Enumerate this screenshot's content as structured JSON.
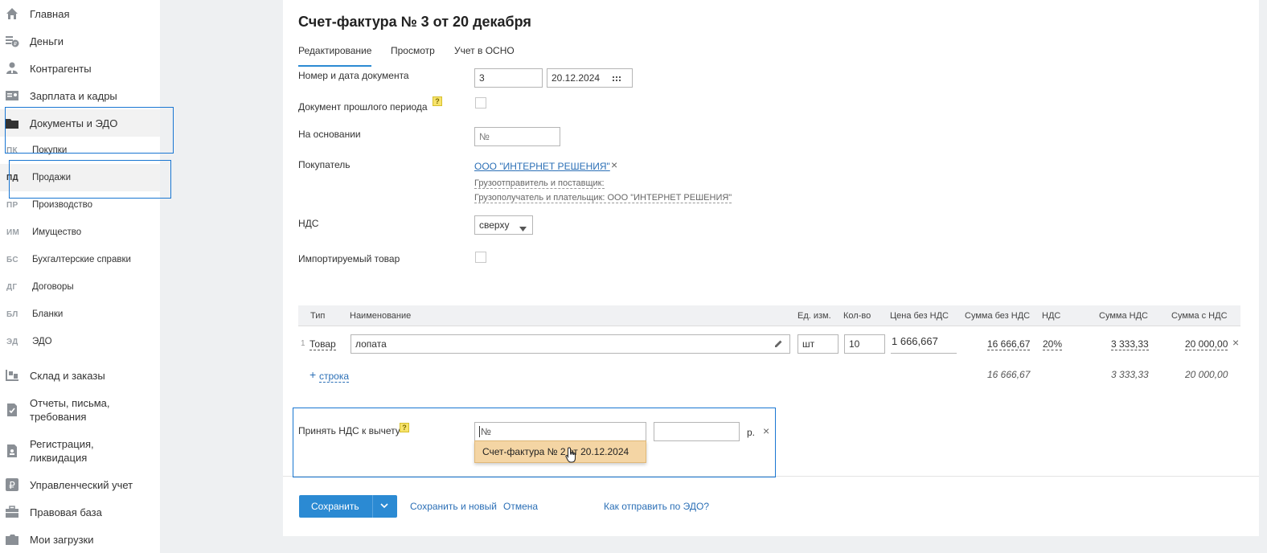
{
  "sidebar": {
    "items_top": [
      {
        "label": "Главная",
        "icon": "home-icon"
      },
      {
        "label": "Деньги",
        "icon": "money-icon"
      },
      {
        "label": "Контрагенты",
        "icon": "contractors-icon"
      },
      {
        "label": "Зарплата и кадры",
        "icon": "salary-icon"
      },
      {
        "label": "Документы и ЭДО",
        "icon": "folder-icon"
      }
    ],
    "sub_items": [
      {
        "code": "ПК",
        "label": "Покупки"
      },
      {
        "code": "ПД",
        "label": "Продажи"
      },
      {
        "code": "ПР",
        "label": "Производство"
      },
      {
        "code": "ИМ",
        "label": "Имущество"
      },
      {
        "code": "БС",
        "label": "Бухгалтерские справки"
      },
      {
        "code": "ДГ",
        "label": "Договоры"
      },
      {
        "code": "БЛ",
        "label": "Бланки"
      },
      {
        "code": "ЭД",
        "label": "ЭДО"
      }
    ],
    "items_bottom": [
      {
        "label": "Склад и заказы",
        "icon": "warehouse-icon"
      },
      {
        "label": "Отчеты, письма,",
        "label2": "требования",
        "icon": "reports-icon"
      },
      {
        "label": "Регистрация,",
        "label2": "ликвидация",
        "icon": "registration-icon"
      },
      {
        "label": "Управленческий учет",
        "icon": "management-icon"
      },
      {
        "label": "Правовая база",
        "icon": "briefcase-icon"
      },
      {
        "label": "Мои загрузки",
        "icon": "downloads-icon"
      }
    ]
  },
  "doc": {
    "title": "Счет-фактура № 3 от 20 декабря",
    "tabs": [
      "Редактирование",
      "Просмотр",
      "Учет в ОСНО"
    ]
  },
  "form": {
    "number_label": "Номер и дата документа",
    "number_value": "3",
    "date_value": "20.12.2024",
    "past_period_label": "Документ прошлого периода",
    "basis_label": "На основании",
    "basis_placeholder": "№",
    "buyer_label": "Покупатель",
    "buyer_value": "ООО \"ИНТЕРНЕТ РЕШЕНИЯ\"",
    "shipper_text": "Грузоотправитель и поставщик:",
    "consignee_text": "Грузополучатель и плательщик: ООО \"ИНТЕРНЕТ РЕШЕНИЯ\"",
    "vat_label": "НДС",
    "vat_value": "сверху",
    "imported_label": "Импортируемый товар",
    "help_mark": "?"
  },
  "table": {
    "headers": [
      "Тип",
      "Наименование",
      "Ед. изм.",
      "Кол-во",
      "Цена без НДС",
      "Сумма без НДС",
      "НДС",
      "Сумма НДС",
      "Сумма с НДС"
    ],
    "row": {
      "index": "1",
      "type": "Товар",
      "name": "лопата",
      "unit": "шт",
      "qty": "10",
      "price": "1 666,667",
      "sum_no_vat": "16 666,67",
      "vat_rate": "20%",
      "vat_sum": "3 333,33",
      "sum_with_vat": "20 000,00"
    },
    "add_row": "строка",
    "totals": {
      "sum_no_vat": "16 666,67",
      "vat_sum": "3 333,33",
      "sum_with_vat": "20 000,00"
    }
  },
  "deduction": {
    "label": "Принять НДС к вычету",
    "placeholder": "№",
    "currency": "р.",
    "suggestion": "Счет-фактура № 2 от 20.12.2024"
  },
  "footer": {
    "save": "Сохранить",
    "save_new": "Сохранить и новый",
    "cancel": "Отмена",
    "edo_link": "Как отправить по ЭДО?"
  },
  "colors": {
    "accent": "#2b8ad3",
    "link": "#2b6fb6",
    "highlight_box": "#1976d2",
    "suggestion_bg": "#f4d5a4"
  }
}
